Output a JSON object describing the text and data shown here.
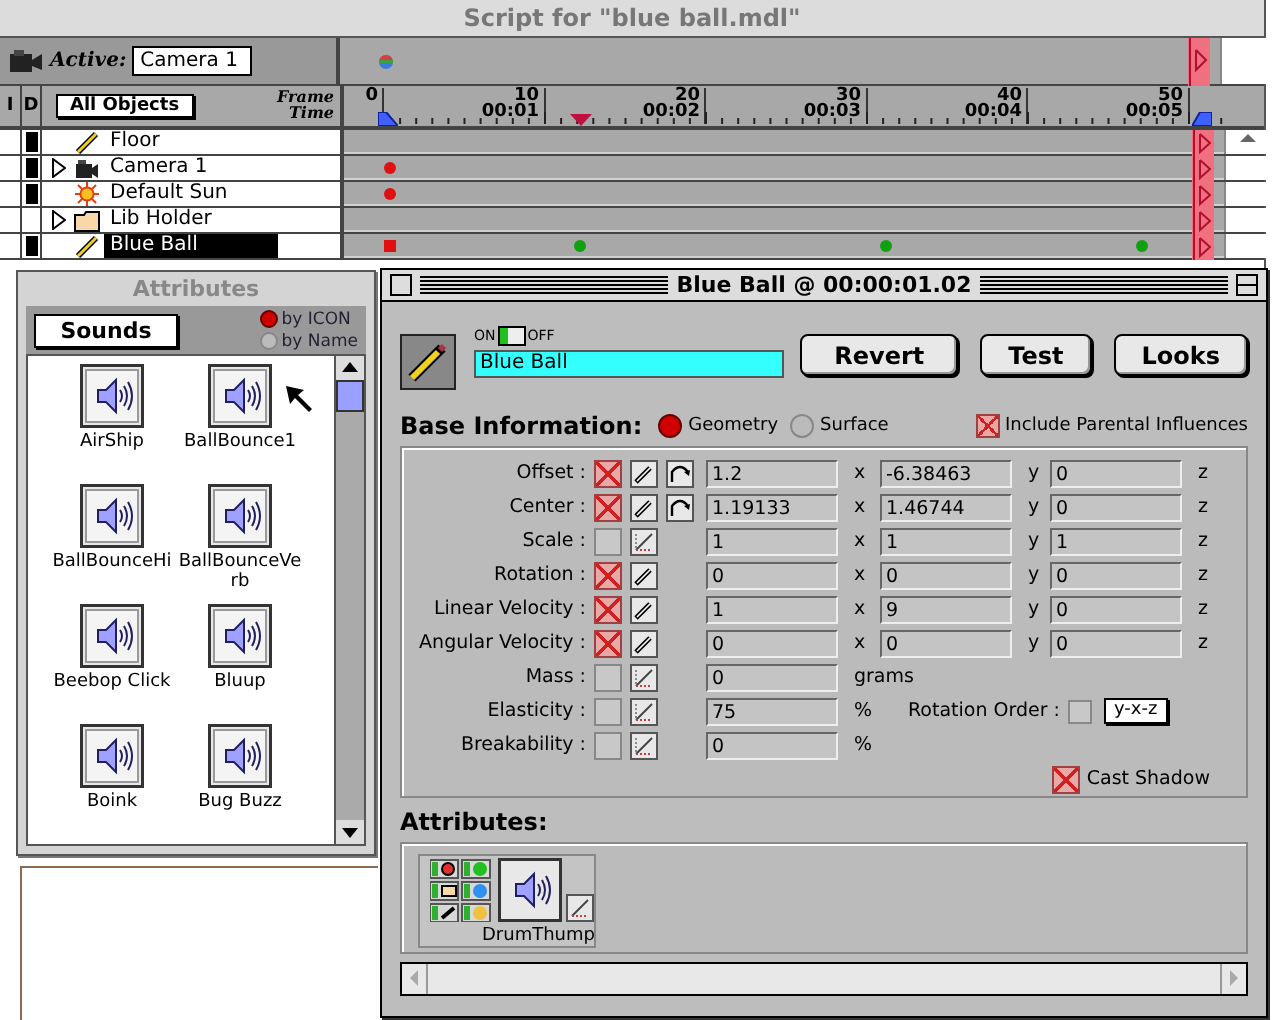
{
  "script_window": {
    "title": "Script for \"blue ball.mdl\"",
    "active_label": "Active:",
    "active_camera": "Camera 1",
    "filter_button": "All Objects",
    "col_i": "I",
    "col_d": "D",
    "frame_label": "Frame",
    "time_label": "Time",
    "ruler": [
      {
        "frame": "0"
      },
      {
        "frame": "10",
        "time": "00:01"
      },
      {
        "frame": "20",
        "time": "00:02"
      },
      {
        "frame": "30",
        "time": "00:03"
      },
      {
        "frame": "40",
        "time": "00:04"
      },
      {
        "frame": "50",
        "time": "00:05"
      }
    ],
    "rows": [
      {
        "name": "Floor",
        "kind": "object",
        "visible": true,
        "disclosure": false,
        "selected": false
      },
      {
        "name": "Camera 1",
        "kind": "camera",
        "visible": true,
        "disclosure": true,
        "selected": false,
        "keys": [
          {
            "kind": "dot",
            "color": "#e01010",
            "level": 0.052
          }
        ]
      },
      {
        "name": "Default Sun",
        "kind": "light",
        "visible": true,
        "disclosure": false,
        "selected": false,
        "keys": [
          {
            "kind": "dot",
            "color": "#e01010",
            "level": 0.052
          }
        ]
      },
      {
        "name": "Lib Holder",
        "kind": "folder",
        "visible": false,
        "disclosure": true,
        "selected": false
      },
      {
        "name": "Blue Ball",
        "kind": "object",
        "visible": true,
        "disclosure": false,
        "selected": true,
        "keys": [
          {
            "kind": "square",
            "color": "#e01010",
            "level": 0.052
          },
          {
            "kind": "dot",
            "color": "#10a010",
            "level": 0.268
          },
          {
            "kind": "dot",
            "color": "#10a010",
            "level": 0.616
          },
          {
            "kind": "dot",
            "color": "#10a010",
            "level": 0.907
          }
        ]
      }
    ]
  },
  "palette": {
    "title": "Attributes",
    "category_button": "Sounds",
    "view_options": [
      {
        "label": "by ICON",
        "selected": true
      },
      {
        "label": "by Name",
        "selected": false
      }
    ],
    "items": [
      {
        "label": "AirShip"
      },
      {
        "label": "BallBounce1"
      },
      {
        "label": "BallBounceHi"
      },
      {
        "label": "BallBounceVerb"
      },
      {
        "label": "Beebop Click"
      },
      {
        "label": "Bluup"
      },
      {
        "label": "Boink"
      },
      {
        "label": "Bug Buzz"
      }
    ]
  },
  "dialog": {
    "title": "Blue Ball @ 00:00:01.02",
    "switch_on_label": "ON",
    "switch_off_label": "OFF",
    "on": true,
    "name": "Blue Ball",
    "buttons": [
      "Revert",
      "Test",
      "Looks"
    ],
    "section_title": "Base Information:",
    "modes": [
      {
        "label": "Geometry",
        "selected": true
      },
      {
        "label": "Surface",
        "selected": false
      }
    ],
    "include_parental": {
      "label": "Include Parental Influences",
      "checked": true
    },
    "properties": [
      {
        "label": "Offset :",
        "checked": true,
        "kind": "pencil",
        "curve": true,
        "values": [
          "1.2",
          "-6.38463",
          "0"
        ],
        "axes": [
          "x",
          "y",
          "z"
        ]
      },
      {
        "label": "Center :",
        "checked": true,
        "kind": "pencil",
        "curve": true,
        "values": [
          "1.19133",
          "1.46744",
          "0"
        ],
        "axes": [
          "x",
          "y",
          "z"
        ]
      },
      {
        "label": "Scale :",
        "checked": false,
        "kind": "graph",
        "curve": false,
        "values": [
          "1",
          "1",
          "1"
        ],
        "axes": [
          "x",
          "y",
          "z"
        ]
      },
      {
        "label": "Rotation :",
        "checked": true,
        "kind": "pencil",
        "curve": false,
        "values": [
          "0",
          "0",
          "0"
        ],
        "axes": [
          "x",
          "y",
          "z"
        ]
      },
      {
        "label": "Linear Velocity :",
        "checked": true,
        "kind": "pencil",
        "curve": false,
        "values": [
          "1",
          "9",
          "0"
        ],
        "axes": [
          "x",
          "y",
          "z"
        ]
      },
      {
        "label": "Angular Velocity :",
        "checked": true,
        "kind": "pencil",
        "curve": false,
        "values": [
          "0",
          "0",
          "0"
        ],
        "axes": [
          "x",
          "y",
          "z"
        ]
      },
      {
        "label": "Mass :",
        "checked": false,
        "kind": "graph",
        "curve": false,
        "values": [
          "0"
        ],
        "unit": "grams"
      },
      {
        "label": "Elasticity :",
        "checked": false,
        "kind": "graph",
        "curve": false,
        "values": [
          "75"
        ],
        "unit": "%",
        "option": {
          "label": "Rotation Order :",
          "checked": false,
          "value": "y-x-z"
        }
      },
      {
        "label": "Breakability :",
        "checked": false,
        "kind": "graph",
        "curve": false,
        "values": [
          "0"
        ],
        "unit": "%"
      }
    ],
    "cast_shadow": {
      "label": "Cast Shadow",
      "checked": true
    },
    "attributes_title": "Attributes:",
    "attribute_items": [
      {
        "label": "DrumThump"
      }
    ]
  }
}
